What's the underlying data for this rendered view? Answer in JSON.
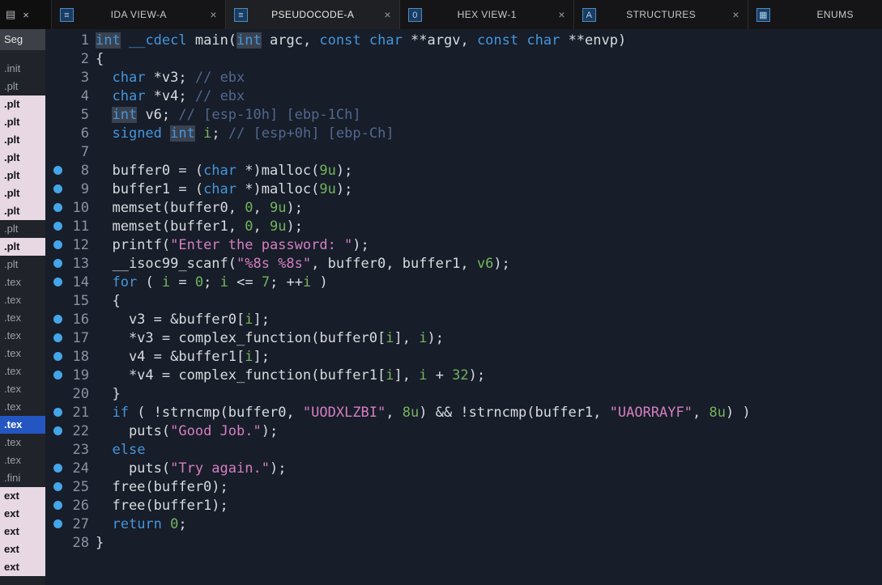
{
  "window": {
    "controls": [
      {
        "name": "document-icon",
        "glyph": "▤"
      },
      {
        "name": "close-window-icon",
        "glyph": "×"
      }
    ]
  },
  "tabs": [
    {
      "label": "IDA VIEW-A",
      "icon": "ida-view-icon",
      "icon_glyph": "≡",
      "close_glyph": "×",
      "active": false
    },
    {
      "label": "PSEUDOCODE-A",
      "icon": "pseudocode-icon",
      "icon_glyph": "≡",
      "close_glyph": "×",
      "active": true
    },
    {
      "label": "HEX VIEW-1",
      "icon": "hex-view-icon",
      "icon_glyph": "0",
      "close_glyph": "×",
      "active": false
    },
    {
      "label": "STRUCTURES",
      "icon": "structures-icon",
      "icon_glyph": "A",
      "close_glyph": "×",
      "active": false
    },
    {
      "label": "ENUMS",
      "icon": "enums-icon",
      "icon_glyph": "▦",
      "close_glyph": "×",
      "active": false
    }
  ],
  "sidebar": {
    "header": "Seg",
    "rows": [
      {
        "label": ".init",
        "style": "normal"
      },
      {
        "label": ".plt",
        "style": "normal"
      },
      {
        "label": ".plt",
        "style": "pink"
      },
      {
        "label": ".plt",
        "style": "pink"
      },
      {
        "label": ".plt",
        "style": "pink"
      },
      {
        "label": ".plt",
        "style": "pink"
      },
      {
        "label": ".plt",
        "style": "pink"
      },
      {
        "label": ".plt",
        "style": "pink"
      },
      {
        "label": ".plt",
        "style": "pink"
      },
      {
        "label": ".plt",
        "style": "normal"
      },
      {
        "label": ".plt",
        "style": "pink"
      },
      {
        "label": ".plt",
        "style": "normal"
      },
      {
        "label": ".tex",
        "style": "normal"
      },
      {
        "label": ".tex",
        "style": "normal"
      },
      {
        "label": ".tex",
        "style": "normal"
      },
      {
        "label": ".tex",
        "style": "normal"
      },
      {
        "label": ".tex",
        "style": "normal"
      },
      {
        "label": ".tex",
        "style": "normal"
      },
      {
        "label": ".tex",
        "style": "normal"
      },
      {
        "label": ".tex",
        "style": "normal"
      },
      {
        "label": ".tex",
        "style": "selected"
      },
      {
        "label": ".tex",
        "style": "normal"
      },
      {
        "label": ".tex",
        "style": "normal"
      },
      {
        "label": ".fini",
        "style": "normal"
      },
      {
        "label": "ext",
        "style": "pink"
      },
      {
        "label": "ext",
        "style": "pink"
      },
      {
        "label": "ext",
        "style": "pink"
      },
      {
        "label": "ext",
        "style": "pink"
      },
      {
        "label": "ext",
        "style": "pink"
      }
    ]
  },
  "editor": {
    "lines": [
      {
        "num": 1,
        "bp": false,
        "tokens": [
          [
            "kwh",
            "int"
          ],
          [
            "pl",
            " "
          ],
          [
            "kw",
            "__cdecl"
          ],
          [
            "pl",
            " main("
          ],
          [
            "kwh",
            "int"
          ],
          [
            "pl",
            " argc, "
          ],
          [
            "kw",
            "const"
          ],
          [
            "pl",
            " "
          ],
          [
            "kw",
            "char"
          ],
          [
            "pl",
            " **argv, "
          ],
          [
            "kw",
            "const"
          ],
          [
            "pl",
            " "
          ],
          [
            "kw",
            "char"
          ],
          [
            "pl",
            " **envp)"
          ]
        ]
      },
      {
        "num": 2,
        "bp": false,
        "tokens": [
          [
            "pl",
            "{"
          ]
        ]
      },
      {
        "num": 3,
        "bp": false,
        "tokens": [
          [
            "pl",
            "  "
          ],
          [
            "kw",
            "char"
          ],
          [
            "pl",
            " *v3; "
          ],
          [
            "com",
            "// ebx"
          ]
        ]
      },
      {
        "num": 4,
        "bp": false,
        "tokens": [
          [
            "pl",
            "  "
          ],
          [
            "kw",
            "char"
          ],
          [
            "pl",
            " *v4; "
          ],
          [
            "com",
            "// ebx"
          ]
        ]
      },
      {
        "num": 5,
        "bp": false,
        "tokens": [
          [
            "pl",
            "  "
          ],
          [
            "kwh",
            "int"
          ],
          [
            "pl",
            " v6; "
          ],
          [
            "com",
            "// [esp-10h] [ebp-1Ch]"
          ]
        ]
      },
      {
        "num": 6,
        "bp": false,
        "tokens": [
          [
            "pl",
            "  "
          ],
          [
            "kw",
            "signed"
          ],
          [
            "pl",
            " "
          ],
          [
            "kwh",
            "int"
          ],
          [
            "pl",
            " "
          ],
          [
            "var",
            "i"
          ],
          [
            "pl",
            "; "
          ],
          [
            "com",
            "// [esp+0h] [ebp-Ch]"
          ]
        ]
      },
      {
        "num": 7,
        "bp": false,
        "tokens": []
      },
      {
        "num": 8,
        "bp": true,
        "tokens": [
          [
            "pl",
            "  buffer0 = ("
          ],
          [
            "kw",
            "char"
          ],
          [
            "pl",
            " *)malloc("
          ],
          [
            "num",
            "9u"
          ],
          [
            "pl",
            ");"
          ]
        ]
      },
      {
        "num": 9,
        "bp": true,
        "tokens": [
          [
            "pl",
            "  buffer1 = ("
          ],
          [
            "kw",
            "char"
          ],
          [
            "pl",
            " *)malloc("
          ],
          [
            "num",
            "9u"
          ],
          [
            "pl",
            ");"
          ]
        ]
      },
      {
        "num": 10,
        "bp": true,
        "tokens": [
          [
            "pl",
            "  memset(buffer0, "
          ],
          [
            "num",
            "0"
          ],
          [
            "pl",
            ", "
          ],
          [
            "num",
            "9u"
          ],
          [
            "pl",
            ");"
          ]
        ]
      },
      {
        "num": 11,
        "bp": true,
        "tokens": [
          [
            "pl",
            "  memset(buffer1, "
          ],
          [
            "num",
            "0"
          ],
          [
            "pl",
            ", "
          ],
          [
            "num",
            "9u"
          ],
          [
            "pl",
            ");"
          ]
        ]
      },
      {
        "num": 12,
        "bp": true,
        "tokens": [
          [
            "pl",
            "  printf("
          ],
          [
            "str",
            "\"Enter the password: \""
          ],
          [
            "pl",
            ");"
          ]
        ]
      },
      {
        "num": 13,
        "bp": true,
        "tokens": [
          [
            "pl",
            "  __isoc99_scanf("
          ],
          [
            "str",
            "\"%8s %8s\""
          ],
          [
            "pl",
            ", buffer0, buffer1, "
          ],
          [
            "var",
            "v6"
          ],
          [
            "pl",
            ");"
          ]
        ]
      },
      {
        "num": 14,
        "bp": true,
        "tokens": [
          [
            "pl",
            "  "
          ],
          [
            "kw",
            "for"
          ],
          [
            "pl",
            " ( "
          ],
          [
            "var",
            "i"
          ],
          [
            "pl",
            " = "
          ],
          [
            "num",
            "0"
          ],
          [
            "pl",
            "; "
          ],
          [
            "var",
            "i"
          ],
          [
            "pl",
            " <= "
          ],
          [
            "num",
            "7"
          ],
          [
            "pl",
            "; ++"
          ],
          [
            "var",
            "i"
          ],
          [
            "pl",
            " )"
          ]
        ]
      },
      {
        "num": 15,
        "bp": false,
        "tokens": [
          [
            "pl",
            "  {"
          ]
        ]
      },
      {
        "num": 16,
        "bp": true,
        "tokens": [
          [
            "pl",
            "    v3 = &buffer0["
          ],
          [
            "var",
            "i"
          ],
          [
            "pl",
            "];"
          ]
        ]
      },
      {
        "num": 17,
        "bp": true,
        "tokens": [
          [
            "pl",
            "    *v3 = complex_function(buffer0["
          ],
          [
            "var",
            "i"
          ],
          [
            "pl",
            "], "
          ],
          [
            "var",
            "i"
          ],
          [
            "pl",
            ");"
          ]
        ]
      },
      {
        "num": 18,
        "bp": true,
        "tokens": [
          [
            "pl",
            "    v4 = &buffer1["
          ],
          [
            "var",
            "i"
          ],
          [
            "pl",
            "];"
          ]
        ]
      },
      {
        "num": 19,
        "bp": true,
        "tokens": [
          [
            "pl",
            "    *v4 = complex_function(buffer1["
          ],
          [
            "var",
            "i"
          ],
          [
            "pl",
            "], "
          ],
          [
            "var",
            "i"
          ],
          [
            "pl",
            " + "
          ],
          [
            "num",
            "32"
          ],
          [
            "pl",
            ");"
          ]
        ]
      },
      {
        "num": 20,
        "bp": false,
        "tokens": [
          [
            "pl",
            "  }"
          ]
        ]
      },
      {
        "num": 21,
        "bp": true,
        "tokens": [
          [
            "pl",
            "  "
          ],
          [
            "kw",
            "if"
          ],
          [
            "pl",
            " ( !strncmp(buffer0, "
          ],
          [
            "str",
            "\"UODXLZBI\""
          ],
          [
            "pl",
            ", "
          ],
          [
            "num",
            "8u"
          ],
          [
            "pl",
            ") && !strncmp(buffer1, "
          ],
          [
            "str",
            "\"UAORRAYF\""
          ],
          [
            "pl",
            ", "
          ],
          [
            "num",
            "8u"
          ],
          [
            "pl",
            ") )"
          ]
        ]
      },
      {
        "num": 22,
        "bp": true,
        "tokens": [
          [
            "pl",
            "    puts("
          ],
          [
            "str",
            "\"Good Job.\""
          ],
          [
            "pl",
            ");"
          ]
        ]
      },
      {
        "num": 23,
        "bp": false,
        "tokens": [
          [
            "pl",
            "  "
          ],
          [
            "kw",
            "else"
          ]
        ]
      },
      {
        "num": 24,
        "bp": true,
        "tokens": [
          [
            "pl",
            "    puts("
          ],
          [
            "str",
            "\"Try again.\""
          ],
          [
            "pl",
            ");"
          ]
        ]
      },
      {
        "num": 25,
        "bp": true,
        "tokens": [
          [
            "pl",
            "  free(buffer0);"
          ]
        ]
      },
      {
        "num": 26,
        "bp": true,
        "tokens": [
          [
            "pl",
            "  free(buffer1);"
          ]
        ]
      },
      {
        "num": 27,
        "bp": true,
        "tokens": [
          [
            "pl",
            "  "
          ],
          [
            "kw",
            "return"
          ],
          [
            "pl",
            " "
          ],
          [
            "num",
            "0"
          ],
          [
            "pl",
            ";"
          ]
        ]
      },
      {
        "num": 28,
        "bp": false,
        "tokens": [
          [
            "pl",
            "}"
          ]
        ]
      }
    ]
  },
  "colors": {
    "editor-bg": "#171d29",
    "sidebar-bg": "#202329",
    "tabbar-bg": "#0f0f10",
    "tab-bg": "#151517",
    "tab-active-bg": "#1f2023",
    "seg-header-bg": "#3d4046",
    "keyword": "#4596db",
    "string": "#d57fc1",
    "number": "#74b35c",
    "comment": "#52688f",
    "plain": "#d8dbe0",
    "variable": "#79b65e",
    "breakpoint": "#44a5e8",
    "highlight-bg": "#3a4250",
    "selected-row-bg": "#2356c0",
    "pink-row-bg": "#e7d8e3",
    "line-number": "#8a93a2"
  }
}
